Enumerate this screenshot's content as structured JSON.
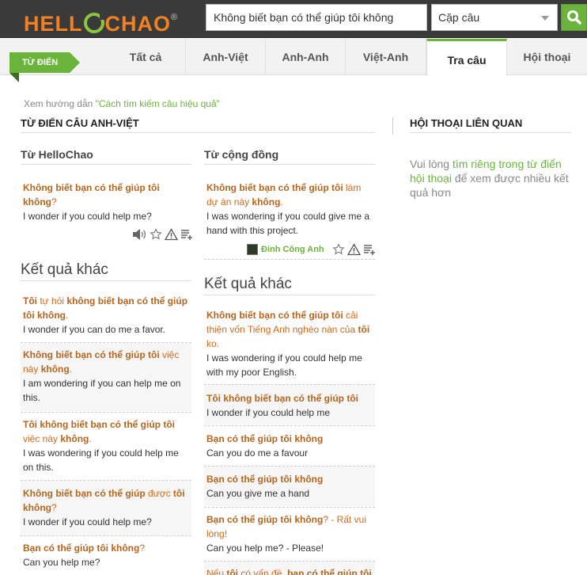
{
  "header": {
    "logo_text": "HELL",
    "logo_text2": "CHAO",
    "logo_mark": "®",
    "search_value": "Không biết bạn có thể giúp tôi không",
    "select_value": "Cặp câu",
    "search_icon": "search-icon"
  },
  "tabs": {
    "badge": "TỪ ĐIỂN",
    "items": [
      "Tất cả",
      "Anh-Việt",
      "Anh-Anh",
      "Việt-Anh",
      "Tra câu",
      "Hội thoại"
    ],
    "active": "Tra câu"
  },
  "hint": {
    "prefix": "Xem hướng dẫn ",
    "link": "\"Cách tìm kiếm câu hiệu quả\""
  },
  "left": {
    "section_title": "TỪ ĐIỂN CÂU ANH-VIỆT",
    "col1_title": "Từ HelloChao",
    "col2_title": "Từ cộng đồng",
    "other_title": "Kết quả khác",
    "hello": {
      "vi_html": "<b>Không biết bạn có thể giúp tôi không</b>?",
      "en": "I wonder if you could help me?"
    },
    "community": {
      "vi_html": "<b>Không biết bạn có thể giúp tôi</b> làm dự án này <b>không</b>.",
      "en": "I was wondering if you could give me a hand with this project.",
      "author": "Đinh Công Anh"
    },
    "col1_results": [
      {
        "vi": "<b>Tôi</b> tự hỏi <b>không biết bạn có thể giúp tôi không</b>.",
        "en": "I wonder if you can do me a favor."
      },
      {
        "vi": "<b>Không biết bạn có thể giúp tôi</b> việc này <b>không</b>.",
        "en": "I am wondering if you can help me on this."
      },
      {
        "vi": "<b>Tôi không biết bạn có thể giúp tôi</b> việc này <b>không</b>.",
        "en": "I was wondering if you could help me on this."
      },
      {
        "vi": "<b>Không biết bạn có thể giúp</b> được <b>tôi không</b>?",
        "en": "I wonder if you could help me?"
      },
      {
        "vi": "<b>Bạn có thể giúp tôi không</b>?",
        "en": "Can you help me?"
      }
    ],
    "col2_results": [
      {
        "vi": "<b>Không biết bạn có thể giúp tôi</b> cải thiện vốn Tiếng Anh nghèo nàn của <b>tôi</b> ko.",
        "en": "I was wondering if you could help me with my poor English."
      },
      {
        "vi": "<b>Tôi không biết bạn có thể giúp tôi</b>",
        "en": "I wonder if you could help me"
      },
      {
        "vi": "<b>Bạn có thể giúp tôi không</b>",
        "en": "Can you do me a favour"
      },
      {
        "vi": "<b>Bạn có thể giúp tôi không</b>",
        "en": "Can you give me a hand"
      },
      {
        "vi": "<b>Bạn có thể giúp tôi không</b>? - Rất vui lòng!",
        "en": "Can you help me? - Please!"
      },
      {
        "vi": "Nếu <b>tôi</b> có vấn đề, <b>bạn có thể giúp tôi</b>",
        "en": ""
      }
    ]
  },
  "right": {
    "section_title": "HỘI THOẠI LIÊN QUAN",
    "note_prefix": "Vui lòng ",
    "note_link": "tìm riêng trong từ điển hội thoại",
    "note_suffix": " để xem được nhiều kết quả hơn"
  },
  "colors": {
    "accent": "#6bb43c",
    "brand_orange": "#f48121",
    "vi_text": "#d2691e"
  }
}
